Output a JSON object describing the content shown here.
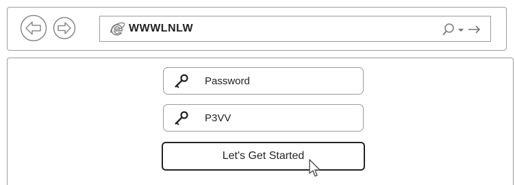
{
  "browser": {
    "address": "WWWLNLW"
  },
  "form": {
    "password_label": "Password",
    "ssid_value": "P3VV",
    "start_button": "Let's Get Started"
  },
  "icons": {
    "back": "back-arrow-icon",
    "forward": "forward-arrow-icon",
    "browser": "internet-explorer-icon",
    "search": "search-icon",
    "go": "go-arrow-icon",
    "key": "key-icon",
    "cursor": "mouse-cursor-icon"
  }
}
